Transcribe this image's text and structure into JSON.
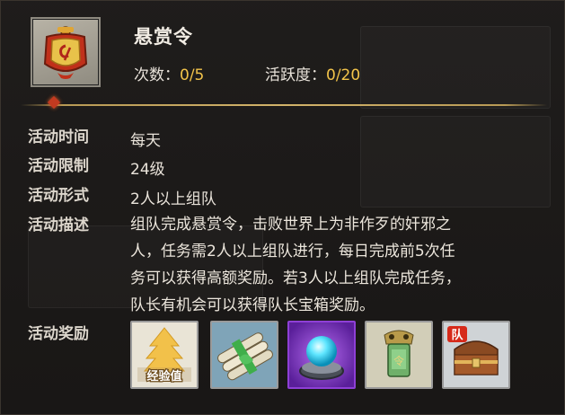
{
  "activity": {
    "title": "悬赏令",
    "count_label": "次数：",
    "count_value": "0/5",
    "activity_label": "活跃度：",
    "activity_value": "0/20"
  },
  "details": {
    "time_label": "活动时间",
    "time_value": "每天",
    "limit_label": "活动限制",
    "limit_value": "24级",
    "form_label": "活动形式",
    "form_value": "2人以上组队",
    "desc_label": "活动描述",
    "desc_lines": [
      "组队完成悬赏令，击败世界上为非作歹的奸邪之",
      "人，任务需2人以上组队进行，每日完成前5次任",
      "务可以获得高额奖励。若3人以上组队完成任务，",
      "队长有机会可以获得队长宝箱奖励。"
    ],
    "reward_label": "活动奖励"
  },
  "rewards": [
    {
      "icon": "exp-icon",
      "caption": "经验值"
    },
    {
      "icon": "scroll-bundle-icon",
      "caption": ""
    },
    {
      "icon": "crystal-orb-icon",
      "caption": ""
    },
    {
      "icon": "jade-token-icon",
      "caption": ""
    },
    {
      "icon": "captain-chest-icon",
      "caption": "队"
    }
  ],
  "colors": {
    "accent_yellow": "#f3c44a",
    "text": "#e9e3da",
    "divider_gold": "#d2b36a",
    "orb_frame_purple": "#8e3fd6"
  }
}
